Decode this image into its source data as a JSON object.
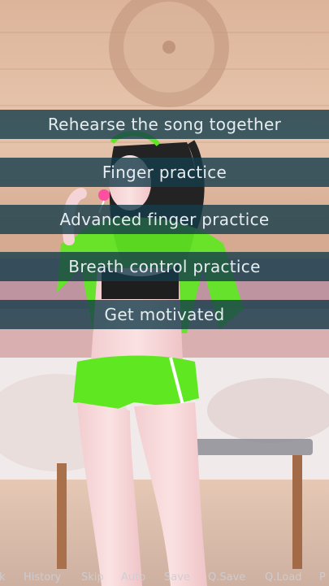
{
  "choices": [
    {
      "label": "Rehearse the song together"
    },
    {
      "label": "Finger practice"
    },
    {
      "label": "Advanced finger practice"
    },
    {
      "label": "Breath control practice"
    },
    {
      "label": "Get motivated"
    }
  ],
  "quick_menu": {
    "back": "k",
    "history": "History",
    "skip": "Skip",
    "auto": "Auto",
    "save": "Save",
    "qsave": "Q.Save",
    "qload": "Q.Load",
    "prefs": "P"
  },
  "colors": {
    "choice_bg": "#143c4b",
    "choice_text": "#e6edf0",
    "outfit_green": "#5fe822"
  }
}
